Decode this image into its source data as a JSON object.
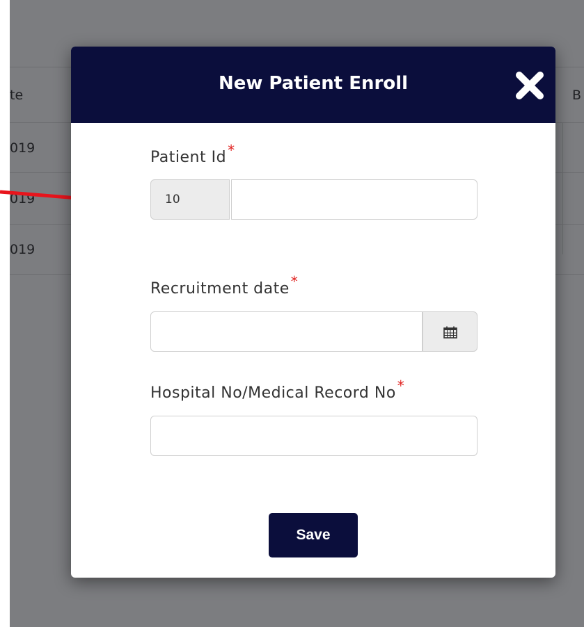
{
  "background": {
    "header_fragment_left": "te",
    "header_fragment_right": "B",
    "rows": [
      {
        "date_fragment": "019"
      },
      {
        "date_fragment": "019"
      },
      {
        "date_fragment": "019"
      }
    ]
  },
  "modal": {
    "title": "New Patient Enroll",
    "close_icon": "close-x-icon",
    "fields": {
      "patient_id": {
        "label": "Patient Id",
        "required_mark": "*",
        "prefix_value": "10",
        "value": ""
      },
      "recruitment_date": {
        "label": "Recruitment date",
        "required_mark": "*",
        "value": "",
        "icon": "calendar-icon"
      },
      "hospital_no": {
        "label": "Hospital No/Medical Record No",
        "required_mark": "*",
        "value": ""
      }
    },
    "save_label": "Save"
  },
  "colors": {
    "header_bg": "#0b0e3c",
    "required": "#e0201e",
    "overlay": "#7c7d80",
    "annotation_arrow": "#e8141c"
  }
}
